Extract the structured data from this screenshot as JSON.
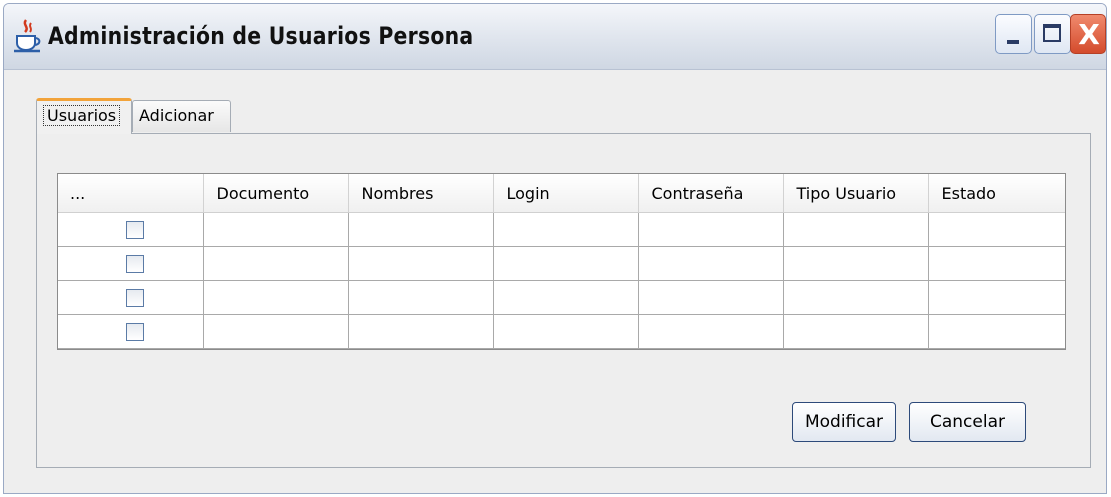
{
  "window": {
    "title": "Administración de Usuarios Persona",
    "controls": {
      "minimize": "minimize",
      "maximize": "maximize",
      "close": "X"
    }
  },
  "tabs": [
    {
      "label": "Usuarios",
      "active": true
    },
    {
      "label": "Adicionar",
      "active": false
    }
  ],
  "table": {
    "columns": [
      "...",
      "Documento",
      "Nombres",
      "Login",
      "Contraseña",
      "Tipo Usuario",
      "Estado"
    ],
    "rows": [
      {
        "checked": false,
        "documento": "",
        "nombres": "",
        "login": "",
        "contrasena": "",
        "tipo_usuario": "",
        "estado": ""
      },
      {
        "checked": false,
        "documento": "",
        "nombres": "",
        "login": "",
        "contrasena": "",
        "tipo_usuario": "",
        "estado": ""
      },
      {
        "checked": false,
        "documento": "",
        "nombres": "",
        "login": "",
        "contrasena": "",
        "tipo_usuario": "",
        "estado": ""
      },
      {
        "checked": false,
        "documento": "",
        "nombres": "",
        "login": "",
        "contrasena": "",
        "tipo_usuario": "",
        "estado": ""
      }
    ]
  },
  "buttons": {
    "modificar": "Modificar",
    "cancelar": "Cancelar"
  },
  "icons": {
    "app": "java-coffee-cup-icon",
    "minimize": "minimize-icon",
    "maximize": "maximize-icon",
    "close": "close-icon"
  },
  "colors": {
    "close_button": "#d44b2c",
    "active_tab_accent": "#f2a33a",
    "window_border": "#9aa9c4"
  }
}
